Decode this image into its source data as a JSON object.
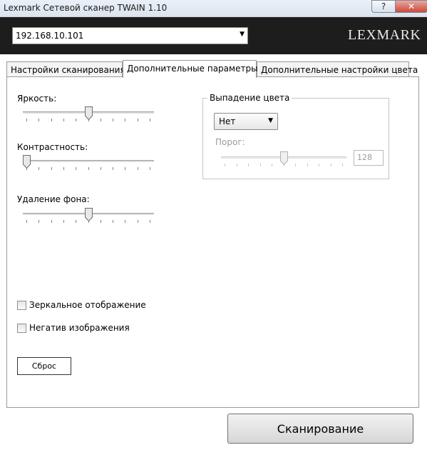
{
  "window": {
    "title": "Lexmark Сетевой сканер TWAIN  1.10",
    "help_glyph": "?",
    "close_glyph": "✕"
  },
  "header": {
    "address": "192.168.10.101",
    "address_arrow": "▼",
    "logo": "LEXMARK"
  },
  "tabs": [
    {
      "label": "Настройки сканирования",
      "active": false
    },
    {
      "label": "Дополнительные параметры",
      "active": true
    },
    {
      "label": "Дополнительные настройки цвета",
      "active": false
    }
  ],
  "sliders": {
    "brightness": {
      "label": "Яркость:",
      "value": 0.5
    },
    "contrast": {
      "label": "Контрастность:",
      "value": 0.0
    },
    "background_removal": {
      "label": "Удаление фона:",
      "value": 0.5
    }
  },
  "color_dropout": {
    "legend": "Выпадение цвета",
    "selected": "Нет",
    "arrow": "▼",
    "threshold_label": "Порог:",
    "threshold_value": "128",
    "threshold_level": 0.5
  },
  "checkboxes": {
    "mirror": {
      "label": "Зеркальное отображение",
      "checked": false
    },
    "negative": {
      "label": "Негатив изображения",
      "checked": false
    }
  },
  "buttons": {
    "reset": "Сброс",
    "scan": "Сканирование"
  },
  "colors": {
    "header_bg": "#1d1d1d",
    "close_button": "#c94a3b"
  }
}
